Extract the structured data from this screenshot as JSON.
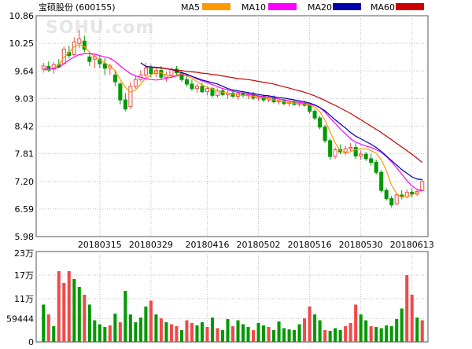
{
  "stock": {
    "name": "宝硕股份",
    "code": "(600155)"
  },
  "legend": [
    {
      "label": "MA5",
      "color": "#ff9900"
    },
    {
      "label": "MA10",
      "color": "#ff00ff"
    },
    {
      "label": "MA20",
      "color": "#0000aa"
    },
    {
      "label": "MA60",
      "color": "#cc0000"
    }
  ],
  "watermark": "SOHU.com",
  "colors": {
    "up": "#ef4a4a",
    "down": "#009900",
    "grid": "#bdbdbd",
    "frame": "#555555"
  },
  "chart_data": [
    {
      "type": "candlestick",
      "y_ticks": [
        "10.86",
        "10.25",
        "9.64",
        "9.03",
        "8.42",
        "7.81",
        "7.20",
        "6.59",
        "5.98"
      ],
      "ylim": [
        5.98,
        10.86
      ],
      "x_ticks": [
        {
          "label": "20180315",
          "index": 11
        },
        {
          "label": "20180329",
          "index": 21
        },
        {
          "label": "20180416",
          "index": 32
        },
        {
          "label": "20180502",
          "index": 42
        },
        {
          "label": "20180516",
          "index": 52
        },
        {
          "label": "20180530",
          "index": 62
        },
        {
          "label": "20180613",
          "index": 72
        }
      ],
      "series": [
        {
          "name": "MA5",
          "color": "#ff9900",
          "values": [
            9.66,
            9.67,
            9.7,
            9.78,
            9.94,
            10.05,
            10.18,
            10.22,
            10.18,
            10.05,
            9.95,
            9.88,
            9.82,
            9.75,
            9.65,
            9.45,
            9.28,
            9.17,
            9.22,
            9.35,
            9.48,
            9.55,
            9.62,
            9.6,
            9.55,
            9.52,
            9.55,
            9.58,
            9.53,
            9.48,
            9.4,
            9.33,
            9.28,
            9.24,
            9.2,
            9.17,
            9.15,
            9.13,
            9.11,
            9.1,
            9.09,
            9.08,
            9.06,
            9.05,
            9.03,
            9.0,
            8.98,
            8.96,
            8.94,
            8.93,
            8.92,
            8.91,
            8.89,
            8.84,
            8.74,
            8.55,
            8.3,
            8.05,
            7.88,
            7.82,
            7.86,
            7.9,
            7.92,
            7.92,
            7.88,
            7.82,
            7.68,
            7.43,
            7.12,
            6.93,
            6.85,
            6.86,
            6.9,
            6.96,
            7.02
          ]
        },
        {
          "name": "MA10",
          "color": "#ff00ff",
          "values": [
            9.68,
            9.68,
            9.69,
            9.72,
            9.8,
            9.88,
            9.95,
            10.0,
            10.02,
            10.02,
            10.01,
            9.98,
            9.95,
            9.92,
            9.85,
            9.75,
            9.66,
            9.58,
            9.53,
            9.5,
            9.47,
            9.45,
            9.44,
            9.45,
            9.48,
            9.5,
            9.53,
            9.55,
            9.55,
            9.52,
            9.46,
            9.42,
            9.38,
            9.34,
            9.29,
            9.25,
            9.22,
            9.19,
            9.17,
            9.15,
            9.13,
            9.11,
            9.09,
            9.07,
            9.06,
            9.04,
            9.02,
            9.0,
            8.98,
            8.96,
            8.95,
            8.93,
            8.91,
            8.88,
            8.83,
            8.73,
            8.6,
            8.48,
            8.36,
            8.25,
            8.14,
            8.07,
            8.02,
            7.98,
            7.95,
            7.9,
            7.84,
            7.75,
            7.63,
            7.5,
            7.36,
            7.22,
            7.1,
            7.02,
            6.99
          ]
        },
        {
          "name": "MA20",
          "color": "#0000aa",
          "values": [
            null,
            null,
            null,
            null,
            null,
            null,
            null,
            null,
            null,
            null,
            null,
            null,
            null,
            null,
            null,
            null,
            null,
            null,
            null,
            9.82,
            9.74,
            9.73,
            9.72,
            9.71,
            9.69,
            9.67,
            9.64,
            9.6,
            9.57,
            9.52,
            9.48,
            9.44,
            9.41,
            9.38,
            9.35,
            9.3,
            9.25,
            9.22,
            9.2,
            9.18,
            9.16,
            9.14,
            9.12,
            9.1,
            9.09,
            9.07,
            9.05,
            9.04,
            9.02,
            9.0,
            8.98,
            8.96,
            8.93,
            8.89,
            8.83,
            8.76,
            8.66,
            8.56,
            8.47,
            8.38,
            8.28,
            8.2,
            8.14,
            8.08,
            8.02,
            7.95,
            7.86,
            7.76,
            7.66,
            7.56,
            7.46,
            7.38,
            7.3,
            7.25,
            7.24
          ]
        },
        {
          "name": "MA60",
          "color": "#cc0000",
          "values": [
            null,
            null,
            null,
            null,
            null,
            null,
            null,
            null,
            null,
            null,
            null,
            null,
            null,
            null,
            null,
            null,
            null,
            null,
            null,
            null,
            9.73,
            9.72,
            9.71,
            9.7,
            9.69,
            9.67,
            9.66,
            9.65,
            9.63,
            9.62,
            9.61,
            9.59,
            9.58,
            9.56,
            9.55,
            9.53,
            9.51,
            9.49,
            9.47,
            9.46,
            9.45,
            9.43,
            9.41,
            9.39,
            9.37,
            9.35,
            9.32,
            9.29,
            9.26,
            9.23,
            9.2,
            9.17,
            9.13,
            9.09,
            9.04,
            8.99,
            8.93,
            8.88,
            8.82,
            8.76,
            8.7,
            8.63,
            8.56,
            8.49,
            8.42,
            8.35,
            8.28,
            8.2,
            8.12,
            8.04,
            7.96,
            7.88,
            7.8,
            7.71,
            7.62
          ]
        }
      ],
      "candles": [
        {
          "o": 9.68,
          "h": 9.82,
          "l": 9.6,
          "c": 9.75
        },
        {
          "o": 9.74,
          "h": 9.85,
          "l": 9.62,
          "c": 9.66
        },
        {
          "o": 9.68,
          "h": 9.84,
          "l": 9.58,
          "c": 9.78
        },
        {
          "o": 9.78,
          "h": 9.9,
          "l": 9.7,
          "c": 9.72
        },
        {
          "o": 9.8,
          "h": 10.18,
          "l": 9.78,
          "c": 10.12
        },
        {
          "o": 10.05,
          "h": 10.2,
          "l": 9.92,
          "c": 9.98
        },
        {
          "o": 10.0,
          "h": 10.38,
          "l": 9.98,
          "c": 10.28
        },
        {
          "o": 10.25,
          "h": 10.55,
          "l": 10.15,
          "c": 10.35
        },
        {
          "o": 10.3,
          "h": 10.42,
          "l": 10.05,
          "c": 10.12
        },
        {
          "o": 9.95,
          "h": 10.05,
          "l": 9.75,
          "c": 9.85
        },
        {
          "o": 9.9,
          "h": 10.02,
          "l": 9.7,
          "c": 9.95
        },
        {
          "o": 9.9,
          "h": 9.98,
          "l": 9.7,
          "c": 9.8
        },
        {
          "o": 9.8,
          "h": 9.92,
          "l": 9.55,
          "c": 9.7
        },
        {
          "o": 9.7,
          "h": 9.8,
          "l": 9.55,
          "c": 9.75
        },
        {
          "o": 9.55,
          "h": 9.65,
          "l": 9.3,
          "c": 9.4
        },
        {
          "o": 9.35,
          "h": 9.4,
          "l": 8.9,
          "c": 9.0
        },
        {
          "o": 9.0,
          "h": 9.15,
          "l": 8.75,
          "c": 8.8
        },
        {
          "o": 8.85,
          "h": 9.4,
          "l": 8.8,
          "c": 9.3
        },
        {
          "o": 9.3,
          "h": 9.55,
          "l": 9.25,
          "c": 9.45
        },
        {
          "o": 9.45,
          "h": 9.65,
          "l": 9.4,
          "c": 9.55
        },
        {
          "o": 9.55,
          "h": 9.82,
          "l": 9.5,
          "c": 9.7
        },
        {
          "o": 9.7,
          "h": 9.78,
          "l": 9.5,
          "c": 9.58
        },
        {
          "o": 9.58,
          "h": 9.72,
          "l": 9.5,
          "c": 9.65
        },
        {
          "o": 9.65,
          "h": 9.75,
          "l": 9.45,
          "c": 9.5
        },
        {
          "o": 9.5,
          "h": 9.62,
          "l": 9.4,
          "c": 9.55
        },
        {
          "o": 9.55,
          "h": 9.72,
          "l": 9.5,
          "c": 9.68
        },
        {
          "o": 9.68,
          "h": 9.75,
          "l": 9.55,
          "c": 9.6
        },
        {
          "o": 9.6,
          "h": 9.65,
          "l": 9.4,
          "c": 9.45
        },
        {
          "o": 9.45,
          "h": 9.55,
          "l": 9.3,
          "c": 9.35
        },
        {
          "o": 9.35,
          "h": 9.45,
          "l": 9.2,
          "c": 9.25
        },
        {
          "o": 9.25,
          "h": 9.35,
          "l": 9.15,
          "c": 9.3
        },
        {
          "o": 9.3,
          "h": 9.38,
          "l": 9.15,
          "c": 9.18
        },
        {
          "o": 9.18,
          "h": 9.3,
          "l": 9.1,
          "c": 9.25
        },
        {
          "o": 9.25,
          "h": 9.28,
          "l": 9.05,
          "c": 9.1
        },
        {
          "o": 9.1,
          "h": 9.25,
          "l": 9.05,
          "c": 9.2
        },
        {
          "o": 9.2,
          "h": 9.26,
          "l": 9.08,
          "c": 9.12
        },
        {
          "o": 9.12,
          "h": 9.2,
          "l": 9.02,
          "c": 9.15
        },
        {
          "o": 9.15,
          "h": 9.22,
          "l": 9.05,
          "c": 9.08
        },
        {
          "o": 9.08,
          "h": 9.18,
          "l": 9.0,
          "c": 9.14
        },
        {
          "o": 9.14,
          "h": 9.2,
          "l": 9.05,
          "c": 9.1
        },
        {
          "o": 9.1,
          "h": 9.16,
          "l": 9.02,
          "c": 9.12
        },
        {
          "o": 9.12,
          "h": 9.18,
          "l": 9.0,
          "c": 9.04
        },
        {
          "o": 9.04,
          "h": 9.1,
          "l": 8.98,
          "c": 9.08
        },
        {
          "o": 9.08,
          "h": 9.12,
          "l": 8.95,
          "c": 9.0
        },
        {
          "o": 9.0,
          "h": 9.1,
          "l": 8.95,
          "c": 9.05
        },
        {
          "o": 9.05,
          "h": 9.1,
          "l": 8.92,
          "c": 8.96
        },
        {
          "o": 8.96,
          "h": 9.02,
          "l": 8.9,
          "c": 8.98
        },
        {
          "o": 8.98,
          "h": 9.02,
          "l": 8.88,
          "c": 8.92
        },
        {
          "o": 8.92,
          "h": 8.98,
          "l": 8.86,
          "c": 8.95
        },
        {
          "o": 8.95,
          "h": 9.0,
          "l": 8.88,
          "c": 8.9
        },
        {
          "o": 8.9,
          "h": 8.96,
          "l": 8.85,
          "c": 8.93
        },
        {
          "o": 8.93,
          "h": 8.98,
          "l": 8.85,
          "c": 8.88
        },
        {
          "o": 8.88,
          "h": 8.92,
          "l": 8.7,
          "c": 8.75
        },
        {
          "o": 8.75,
          "h": 8.8,
          "l": 8.55,
          "c": 8.6
        },
        {
          "o": 8.6,
          "h": 8.65,
          "l": 8.35,
          "c": 8.4
        },
        {
          "o": 8.4,
          "h": 8.45,
          "l": 8.05,
          "c": 8.1
        },
        {
          "o": 8.1,
          "h": 8.15,
          "l": 7.68,
          "c": 7.75
        },
        {
          "o": 7.75,
          "h": 7.95,
          "l": 7.7,
          "c": 7.9
        },
        {
          "o": 7.9,
          "h": 8.02,
          "l": 7.8,
          "c": 7.85
        },
        {
          "o": 7.85,
          "h": 7.98,
          "l": 7.78,
          "c": 7.92
        },
        {
          "o": 7.92,
          "h": 8.05,
          "l": 7.85,
          "c": 7.95
        },
        {
          "o": 7.95,
          "h": 8.05,
          "l": 7.7,
          "c": 7.76
        },
        {
          "o": 7.76,
          "h": 7.88,
          "l": 7.68,
          "c": 7.8
        },
        {
          "o": 7.8,
          "h": 7.85,
          "l": 7.65,
          "c": 7.7
        },
        {
          "o": 7.7,
          "h": 7.8,
          "l": 7.55,
          "c": 7.62
        },
        {
          "o": 7.62,
          "h": 7.68,
          "l": 7.35,
          "c": 7.4
        },
        {
          "o": 7.4,
          "h": 7.45,
          "l": 6.95,
          "c": 7.0
        },
        {
          "o": 7.0,
          "h": 7.05,
          "l": 6.78,
          "c": 6.82
        },
        {
          "o": 6.82,
          "h": 6.88,
          "l": 6.62,
          "c": 6.68
        },
        {
          "o": 6.7,
          "h": 6.95,
          "l": 6.68,
          "c": 6.9
        },
        {
          "o": 6.9,
          "h": 7.0,
          "l": 6.8,
          "c": 6.86
        },
        {
          "o": 6.86,
          "h": 7.02,
          "l": 6.82,
          "c": 6.96
        },
        {
          "o": 6.96,
          "h": 7.05,
          "l": 6.85,
          "c": 6.92
        },
        {
          "o": 6.92,
          "h": 7.02,
          "l": 6.88,
          "c": 6.98
        },
        {
          "o": 7.0,
          "h": 7.25,
          "l": 6.98,
          "c": 7.2
        }
      ]
    },
    {
      "type": "bar",
      "y_ticks": [
        "23万",
        "17万",
        "11万",
        "59444",
        "0"
      ],
      "ylim": [
        0,
        230000
      ],
      "values": [
        95000,
        70000,
        40000,
        180000,
        150000,
        180000,
        160000,
        140000,
        120000,
        95000,
        55000,
        45000,
        38000,
        42000,
        72000,
        50000,
        130000,
        70000,
        50000,
        62000,
        90000,
        105000,
        70000,
        60000,
        50000,
        45000,
        40000,
        30000,
        55000,
        48000,
        42000,
        50000,
        38000,
        62000,
        35000,
        30000,
        58000,
        40000,
        55000,
        45000,
        38000,
        30000,
        48000,
        42000,
        38000,
        30000,
        52000,
        35000,
        32000,
        30000,
        45000,
        60000,
        90000,
        70000,
        55000,
        30000,
        28000,
        35000,
        30000,
        40000,
        48000,
        95000,
        70000,
        55000,
        40000,
        38000,
        35000,
        42000,
        40000,
        58000,
        85000,
        170000,
        120000,
        62000,
        55000
      ],
      "up": [
        false,
        true,
        false,
        true,
        true,
        true,
        false,
        false,
        true,
        false,
        false,
        false,
        false,
        true,
        false,
        true,
        false,
        false,
        false,
        false,
        false,
        true,
        false,
        true,
        false,
        true,
        true,
        false,
        true,
        true,
        false,
        false,
        true,
        false,
        true,
        false,
        false,
        true,
        false,
        false,
        false,
        true,
        false,
        false,
        true,
        false,
        false,
        false,
        false,
        false,
        false,
        true,
        true,
        false,
        false,
        true,
        false,
        false,
        false,
        true,
        true,
        true,
        false,
        false,
        true,
        false,
        false,
        false,
        false,
        false,
        false,
        true,
        true,
        false,
        true
      ]
    }
  ]
}
